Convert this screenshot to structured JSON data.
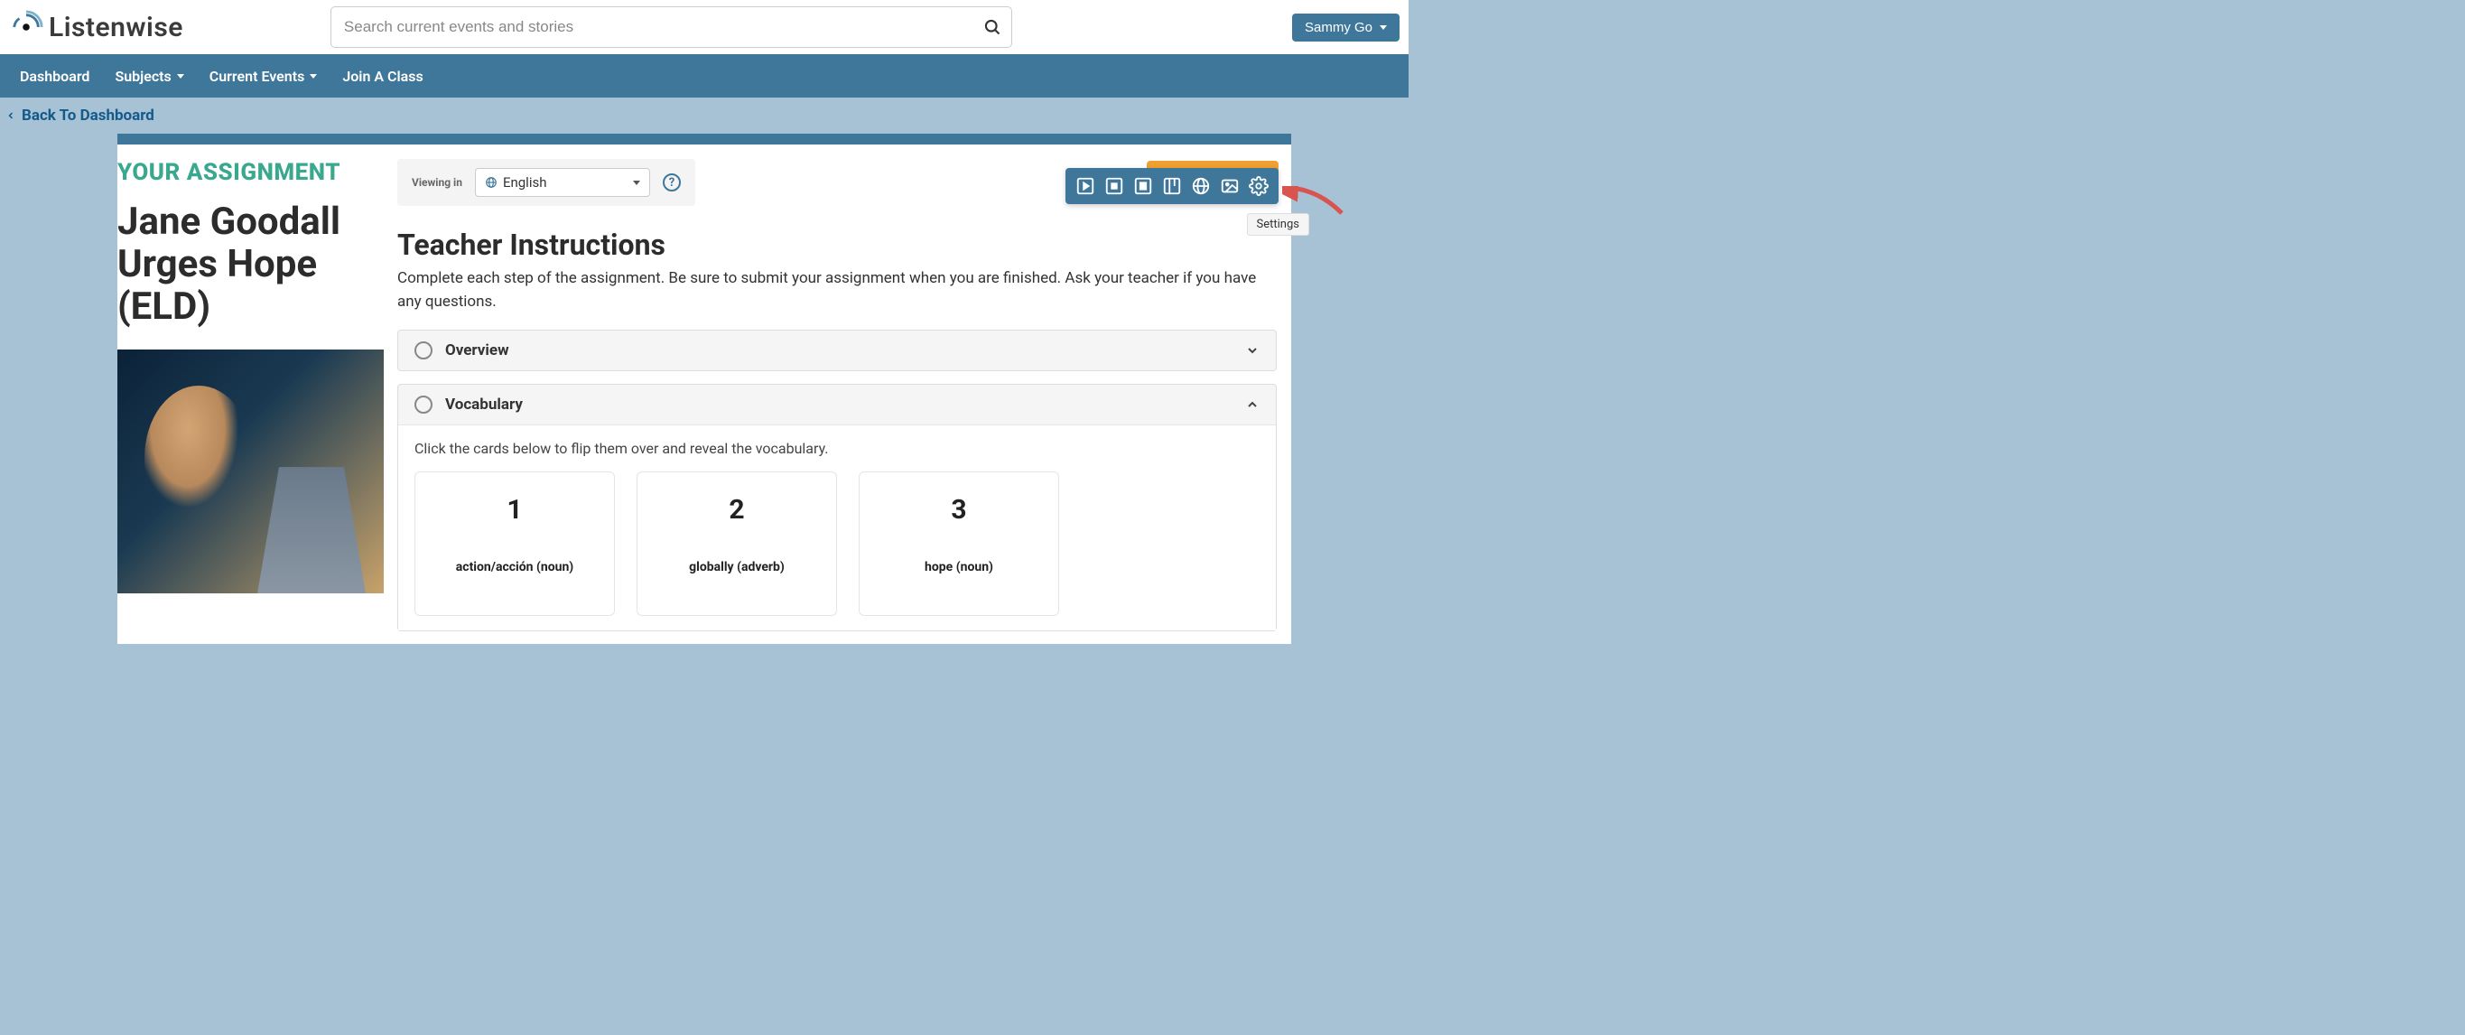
{
  "header": {
    "brand": "Listenwise",
    "search_placeholder": "Search current events and stories",
    "user_name": "Sammy Go"
  },
  "nav": {
    "dashboard": "Dashboard",
    "subjects": "Subjects",
    "current_events": "Current Events",
    "join_class": "Join A Class"
  },
  "breadcrumb": {
    "back": "Back To Dashboard"
  },
  "sidebar": {
    "label": "YOUR ASSIGNMENT",
    "title": "Jane Goodall Urges Hope (ELD)"
  },
  "language": {
    "label": "Viewing in",
    "selected": "English"
  },
  "instructions": {
    "title": "Teacher Instructions",
    "body": "Complete each step of the assignment. Be sure to submit your assignment when you are finished. Ask your teacher if you have any questions."
  },
  "sections": {
    "overview": "Overview",
    "vocabulary": "Vocabulary",
    "vocab_hint": "Click the cards below to flip them over and reveal the vocabulary."
  },
  "vocab_cards": [
    {
      "num": "1",
      "term": "action/acción (noun)"
    },
    {
      "num": "2",
      "term": "globally (adverb)"
    },
    {
      "num": "3",
      "term": "hope (noun)"
    }
  ],
  "toolbar": {
    "tooltip": "Settings"
  }
}
